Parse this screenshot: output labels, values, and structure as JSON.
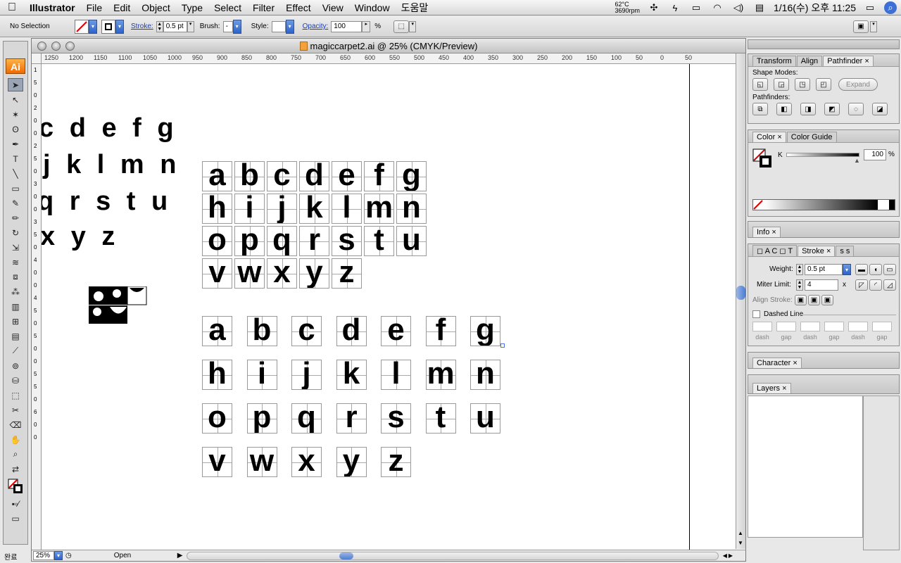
{
  "menubar": {
    "app": "Illustrator",
    "items": [
      "File",
      "Edit",
      "Object",
      "Type",
      "Select",
      "Filter",
      "Effect",
      "View",
      "Window",
      "도움말"
    ],
    "temp": "62°C",
    "rpm": "3690rpm",
    "clock": "1/16(수) 오후 11:25"
  },
  "control": {
    "selection": "No Selection",
    "stroke_label": "Stroke:",
    "stroke_value": "0.5 pt",
    "brush_label": "Brush:",
    "brush_value": "-",
    "style_label": "Style:",
    "opacity_label": "Opacity:",
    "opacity_value": "100",
    "opacity_unit": "%"
  },
  "document": {
    "title": "magiccarpet2.ai @ 25% (CMYK/Preview)",
    "ruler_top": [
      "1250",
      "1200",
      "1150",
      "1100",
      "1050",
      "1000",
      "950",
      "900",
      "850",
      "800",
      "750",
      "700",
      "650",
      "600",
      "550",
      "500",
      "450",
      "400",
      "350",
      "300",
      "250",
      "200",
      "150",
      "100",
      "50",
      "0",
      "50"
    ],
    "ruler_left": [
      "1",
      "5",
      "0",
      "2",
      "0",
      "0",
      "2",
      "5",
      "0",
      "3",
      "0",
      "0",
      "3",
      "5",
      "0",
      "4",
      "0",
      "0",
      "4",
      "5",
      "0",
      "5",
      "0",
      "0",
      "5",
      "5",
      "0",
      "6",
      "0",
      "0"
    ],
    "left_rows": [
      "c d e f g",
      "j k l m n",
      "q r s t u",
      "x y z"
    ],
    "grid1": [
      [
        "a",
        "b",
        "c",
        "d",
        "e",
        "f",
        "g"
      ],
      [
        "h",
        "i",
        "j",
        "k",
        "l",
        "m",
        "n"
      ],
      [
        "o",
        "p",
        "q",
        "r",
        "s",
        "t",
        "u"
      ],
      [
        "v",
        "w",
        "x",
        "y",
        "z"
      ]
    ],
    "grid2": [
      [
        "a",
        "b",
        "c",
        "d",
        "e",
        "f",
        "g"
      ],
      [
        "h",
        "i",
        "j",
        "k",
        "l",
        "m",
        "n"
      ],
      [
        "o",
        "p",
        "q",
        "r",
        "s",
        "t",
        "u"
      ],
      [
        "v",
        "w",
        "x",
        "y",
        "z"
      ]
    ],
    "zoom": "25%",
    "status": "Open"
  },
  "panels": {
    "pathfinder_tabs": [
      "Transform",
      "Align",
      "Pathfinder"
    ],
    "shape_modes": "Shape Modes:",
    "expand": "Expand",
    "pathfinders": "Pathfinders:",
    "color_tabs": [
      "Color",
      "Color Guide"
    ],
    "color_k": "K",
    "color_value": "100",
    "color_unit": "%",
    "info_tab": "Info",
    "stroke_tab": "Stroke",
    "weight_label": "Weight:",
    "weight_value": "0.5 pt",
    "miter_label": "Miter Limit:",
    "miter_value": "4",
    "miter_unit": "x",
    "align_stroke": "Align Stroke:",
    "dashed_line": "Dashed Line",
    "dash_labels": [
      "dash",
      "gap",
      "dash",
      "gap",
      "dash",
      "gap"
    ],
    "character_tab": "Character",
    "layers_tab": "Layers"
  },
  "bottom_left": "완료"
}
